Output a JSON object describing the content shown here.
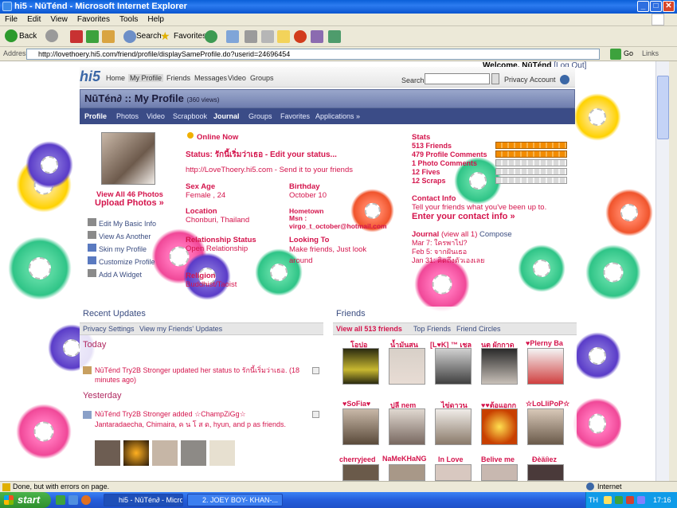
{
  "window": {
    "title": "hi5 - NūTénd - Microsoft Internet Explorer",
    "min": "_",
    "max": "□",
    "close": "✕"
  },
  "menu": [
    "File",
    "Edit",
    "View",
    "Favorites",
    "Tools",
    "Help"
  ],
  "toolbar": {
    "back": "Back",
    "search": "Search",
    "favorites": "Favorites"
  },
  "address": {
    "label": "Address",
    "url": "http://lovethoery.hi5.com/friend/profile/displaySameProfile.do?userid=24696454",
    "go": "Go",
    "links": "Links"
  },
  "hi5": {
    "logo": "hi5",
    "nav": [
      "Home",
      "My Profile",
      "Friends",
      "Messages",
      "Video",
      "Groups"
    ],
    "welcome": "Welcome, NūTénd",
    "logout": "[Log Out]",
    "search_label": "Search",
    "privacy": "Privacy",
    "account": "Account"
  },
  "profile": {
    "title": "NūTén∂ :: My Profile",
    "views": "(360 views)",
    "tabs": [
      "Profile",
      "Photos",
      "Video",
      "Scrapbook",
      "Journal",
      "Groups",
      "Favorites",
      "Applications »"
    ],
    "online": "Online Now",
    "status_label": "Status:",
    "status_text": "รักนี้เริ่มว่าเธอ - Edit your status...",
    "url": "http://LoveThoery.hi5.com - Send it to your friends",
    "view_photos": "View All 46 Photos",
    "upload_photos": "Upload Photos »",
    "actions": [
      "Edit My Basic Info",
      "View As Another",
      "Skin my Profile",
      "Customize Profile",
      "Add A Widget"
    ],
    "sex_age_label": "Sex  Age",
    "sex_age": "Female , 24",
    "birthday_label": "Birthday",
    "birthday": "October 10",
    "location_label": "Location",
    "location": "Chonburi, Thailand",
    "hometown_label": "Hometown",
    "msn_label": "Msn :",
    "msn": "virgo_t_october@hotmail.com",
    "relationship_label": "Relationship Status",
    "relationship": "Open Relationship",
    "looking_label": "Looking To",
    "looking": "Make friends, Just look around",
    "religion_label": "Religion",
    "religion": "Buddhist/Taoist"
  },
  "stats": {
    "label": "Stats",
    "items": [
      "513 Friends",
      "479 Profile Comments",
      "1 Photo Comments",
      "12 Fives",
      "12 Scraps"
    ],
    "contact_label": "Contact Info",
    "contact_text": "Tell your friends what you've been up to.",
    "contact_link": "Enter your contact info »",
    "journal": "Journal",
    "journal_view": "(view all 1)",
    "journal_compose": "Compose",
    "journal_items": [
      "Mar 7: ใครพาไป?",
      "Feb 5: จากฝันเธอ",
      "Jan 31: คิดถึงตัวเองเลย"
    ]
  },
  "updates": {
    "title": "Recent Updates",
    "links": [
      "Privacy Settings",
      "View my Friends' Updates"
    ],
    "today": "Today",
    "today_item": "NūTénd Try2B Stronger updated her status to รักนี้เริ่มว่าเธอ. (18 minutes ago)",
    "yesterday": "Yesterday",
    "yest_item_a": "NūTénd Try2B Stronger added ☆ChampZiGg☆",
    "yest_item_b": "Jantaradaecha, Chimaira, ค น โ ส ด, hyun, and p as friends."
  },
  "friends": {
    "title": "Friends",
    "view_all": "View all 513 friends",
    "top": "Top Friends",
    "circles": "Friend Circles",
    "row1": [
      "โอปอ",
      "น้ำมันสน",
      "[L♥K] ™ เชล",
      "นต ผักกาด",
      "♥Plerny Ba"
    ],
    "row2": [
      "♥SoFia♥",
      "ปูลี nem",
      "ไข่ดาวน",
      "♥♥ต้อแอกก",
      "☆LoLliPoP☆"
    ],
    "row3": [
      "cherryjeed",
      "NaMeKHaNG",
      "In Love",
      "Belive me",
      "Đèäíìez"
    ]
  },
  "statusbar": {
    "text": "Done, but with errors on page.",
    "zone": "Internet"
  },
  "taskbar": {
    "start": "start",
    "tasks": [
      "hi5 - NūTén∂ - Micros...",
      "2. JOEY BOY- KHAN-..."
    ],
    "lang": "TH",
    "time": "17:16"
  }
}
